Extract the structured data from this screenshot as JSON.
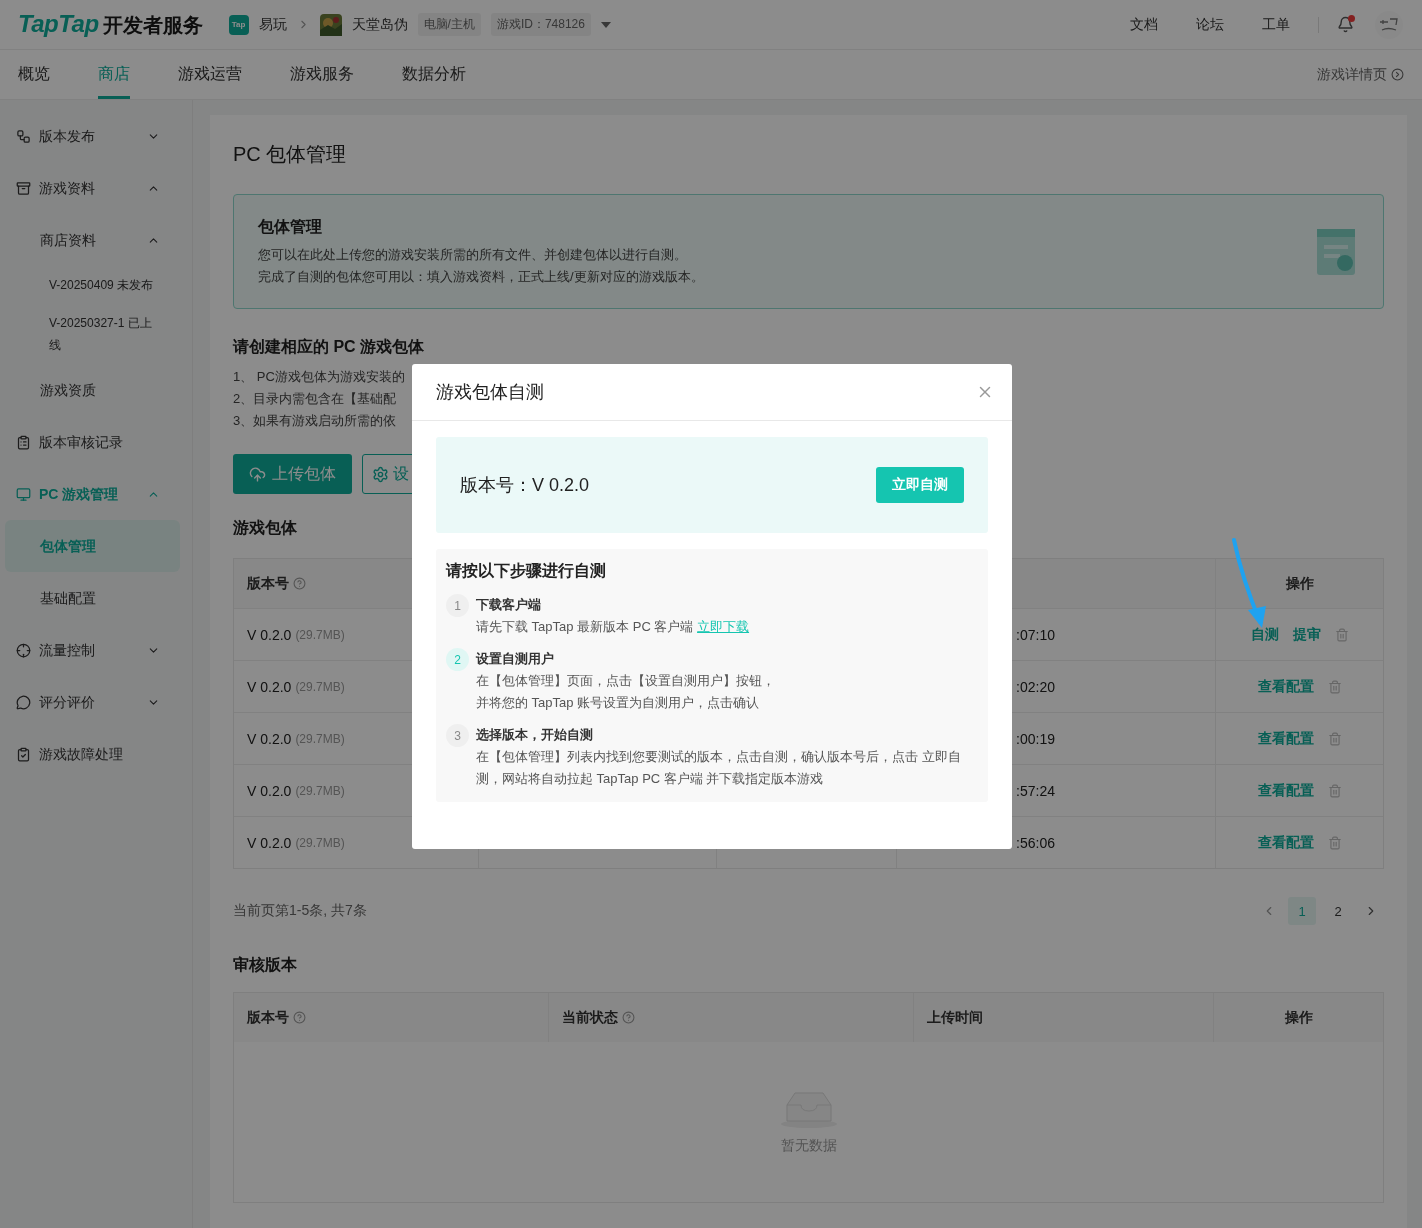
{
  "header": {
    "logo_brand": "TapTap",
    "logo_text": "开发者服务",
    "app": {
      "badge": "Tap",
      "label": "易玩"
    },
    "game": {
      "label": "天堂岛伪",
      "tags": [
        "电脑/主机",
        "游戏ID：748126"
      ]
    },
    "links": [
      "文档",
      "论坛",
      "工单"
    ],
    "unread": true
  },
  "nav": {
    "tabs": [
      {
        "label": "概览",
        "selected": false
      },
      {
        "label": "商店",
        "selected": true
      },
      {
        "label": "游戏运营",
        "selected": false
      },
      {
        "label": "游戏服务",
        "selected": false
      },
      {
        "label": "数据分析",
        "selected": false
      }
    ],
    "detail_link": "游戏详情页"
  },
  "sidebar": {
    "items": [
      {
        "label": "版本发布",
        "expanded": false,
        "selected": false
      },
      {
        "label": "游戏资料",
        "expanded": true,
        "selected": false,
        "children": [
          {
            "label": "商店资料",
            "expanded": true,
            "selected": false,
            "children": [
              {
                "label": "V-20250409 未发布",
                "selected": false
              },
              {
                "label": "V-20250327-1 已上线",
                "selected": false
              }
            ]
          },
          {
            "label": "游戏资质",
            "selected": false
          }
        ]
      },
      {
        "label": "版本审核记录",
        "selected": false
      },
      {
        "label": "PC 游戏管理",
        "expanded": true,
        "selected": false,
        "children": [
          {
            "label": "包体管理",
            "selected": true
          },
          {
            "label": "基础配置",
            "selected": false
          }
        ]
      },
      {
        "label": "流量控制",
        "expanded": false,
        "selected": false
      },
      {
        "label": "评分评价",
        "expanded": false,
        "selected": false
      },
      {
        "label": "游戏故障处理",
        "selected": false
      }
    ]
  },
  "page": {
    "title": "PC 包体管理",
    "info": {
      "title": "包体管理",
      "lines": [
        "您可以在此处上传您的游戏安装所需的所有文件、并创建包体以进行自测。",
        "完成了自测的包体您可用以：填入游戏资料，正式上线/更新对应的游戏版本。"
      ]
    },
    "guide": {
      "title": "请创建相应的 PC 游戏包体",
      "lines": [
        "1、 PC游戏包体为游戏安装的",
        "2、目录内需包含在【基础配",
        "3、如果有游戏启动所需的依"
      ]
    },
    "buttons": [
      {
        "label": "上传包体",
        "kind": "primary"
      },
      {
        "label": "设",
        "kind": "outline"
      }
    ],
    "packages": {
      "title": "游戏包体",
      "columns": [
        {
          "label": "版本号",
          "help": true
        },
        {
          "label": "操作",
          "help": false
        }
      ],
      "rows": [
        {
          "version": "V 0.2.0",
          "size": "(29.7MB)",
          "time": ":07:10",
          "actions": [
            "自测",
            "提审"
          ]
        },
        {
          "version": "V 0.2.0",
          "size": "(29.7MB)",
          "time": ":02:20",
          "actions": [
            "查看配置"
          ]
        },
        {
          "version": "V 0.2.0",
          "size": "(29.7MB)",
          "time": ":00:19",
          "actions": [
            "查看配置"
          ]
        },
        {
          "version": "V 0.2.0",
          "size": "(29.7MB)",
          "time": ":57:24",
          "actions": [
            "查看配置"
          ]
        },
        {
          "version": "V 0.2.0",
          "size": "(29.7MB)",
          "time": ":56:06",
          "actions": [
            "查看配置"
          ]
        }
      ],
      "summary": "当前页第1-5条, 共7条",
      "pages": [
        {
          "label": "1",
          "selected": true
        },
        {
          "label": "2",
          "selected": false
        }
      ]
    },
    "review": {
      "title": "审核版本",
      "columns": [
        {
          "label": "版本号",
          "help": true
        },
        {
          "label": "当前状态",
          "help": true
        },
        {
          "label": "上传时间",
          "help": false
        },
        {
          "label": "操作",
          "help": false
        }
      ],
      "empty": "暂无数据"
    }
  },
  "modal": {
    "title": "游戏包体自测",
    "version": "版本号：V 0.2.0",
    "start_button": "立即自测",
    "steps_title": "请按以下步骤进行自测",
    "steps": [
      {
        "number": "1",
        "title": "下载客户端",
        "lines": [
          "请先下载 TapTap 最新版本 PC 客户端"
        ],
        "link": "立即下载",
        "selected": false
      },
      {
        "number": "2",
        "title": "设置自测用户",
        "lines": [
          "在【包体管理】页面，点击【设置自测用户】按钮，",
          "并将您的 TapTap 账号设置为自测用户，点击确认"
        ],
        "selected": true
      },
      {
        "number": "3",
        "title": "选择版本，开始自测",
        "lines": [
          "在【包体管理】列表内找到您要测试的版本，点击自测，确认版本号后，点击 立即自测，网站将自动拉起 TapTap PC 客户端 并下载指定版本游戏"
        ],
        "selected": false
      }
    ]
  }
}
